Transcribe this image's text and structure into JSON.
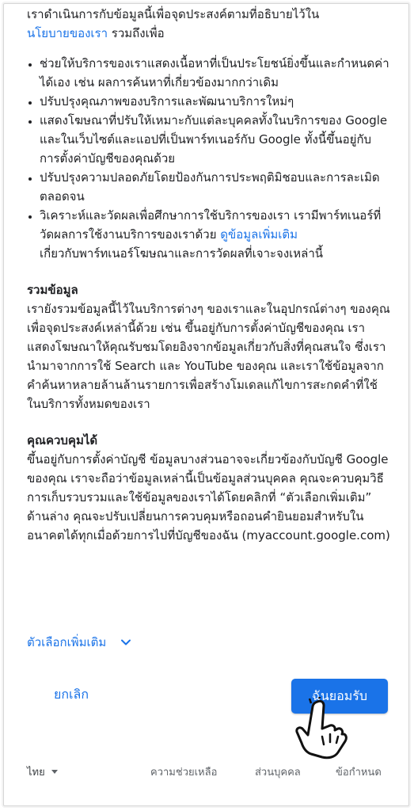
{
  "intro": {
    "line": "เราดำเนินการกับข้อมูลนี้เพื่อจุดประสงค์ตามที่อธิบายไว้ใน",
    "policy_link": "นโยบายของเรา",
    "suffix": " รวมถึงเพื่อ"
  },
  "bullets": [
    "ช่วยให้บริการของเราแสดงเนื้อหาที่เป็นประโยชน์ยิ่งขึ้นและกำหนดค่าได้เอง เช่น ผลการค้นหาที่เกี่ยวข้องมากกว่าเดิม",
    "ปรับปรุงคุณภาพของบริการและพัฒนาบริการใหม่ๆ",
    "แสดงโฆษณาที่ปรับให้เหมาะกับแต่ละบุคคลทั้งในบริการของ Google และในเว็บไซต์และแอปที่เป็นพาร์ทเนอร์กับ Google ทั้งนี้ขึ้นอยู่กับการตั้งค่าบัญชีของคุณด้วย",
    "ปรับปรุงความปลอดภัยโดยป้องกันการประพฤติมิชอบและการละเมิด ตลอดจน"
  ],
  "last_bullet": {
    "text": "วิเคราะห์และวัดผลเพื่อศึกษาการใช้บริการของเรา เรามีพาร์ทเนอร์ที่วัดผลการใช้งานบริการของเราด้วย ",
    "link": "ดูข้อมูลเพิ่มเติม",
    "suffix": "เกี่ยวกับพาร์ทเนอร์โฆษณาและการวัดผลที่เจาะจงเหล่านี้"
  },
  "combine": {
    "title": "รวมข้อมูล",
    "body": "เรายังรวมข้อมูลนี้ไว้ในบริการต่างๆ ของเราและในอุปกรณ์ต่างๆ ของคุณเพื่อจุดประสงค์เหล่านี้ด้วย เช่น ขึ้นอยู่กับการตั้งค่าบัญชีของคุณ เราแสดงโฆษณาให้คุณรับชมโดยอิงจากข้อมูลเกี่ยวกับสิ่งที่คุณสนใจ ซึ่งเรานำมาจากการใช้ Search และ YouTube ของคุณ และเราใช้ข้อมูลจากคำค้นหาหลายล้านล้านรายการเพื่อสร้างโมเดลแก้ไขการสะกดคำที่ใช้ในบริการทั้งหมดของเรา"
  },
  "control": {
    "title": "คุณควบคุมได้",
    "body": "ขึ้นอยู่กับการตั้งค่าบัญชี ข้อมูลบางส่วนอาจจะเกี่ยวข้องกับบัญชี Google ของคุณ เราจะถือว่าข้อมูลเหล่านี้เป็นข้อมูลส่วนบุคคล คุณจะควบคุมวิธีการเก็บรวบรวมและใช้ข้อมูลของเราได้โดยคลิกที่ “ตัวเลือกเพิ่มเติม” ด้านล่าง คุณจะปรับเปลี่ยนการควบคุมหรือถอนคำยินยอมสำหรับในอนาคตได้ทุกเมื่อด้วยการไปที่บัญชีของฉัน (myaccount.google.com)"
  },
  "more_options": {
    "label": "ตัวเลือกเพิ่มเติม",
    "icon": "chevron-down-icon"
  },
  "actions": {
    "cancel": "ยกเลิก",
    "accept": "ฉันยอมรับ"
  },
  "footer": {
    "language": "ไทย",
    "help": "ความช่วยเหลือ",
    "privacy": "ส่วนบุคคล",
    "terms": "ข้อกำหนด"
  },
  "colors": {
    "accent": "#1a73e8",
    "text": "#202124",
    "muted": "#5f6368"
  }
}
